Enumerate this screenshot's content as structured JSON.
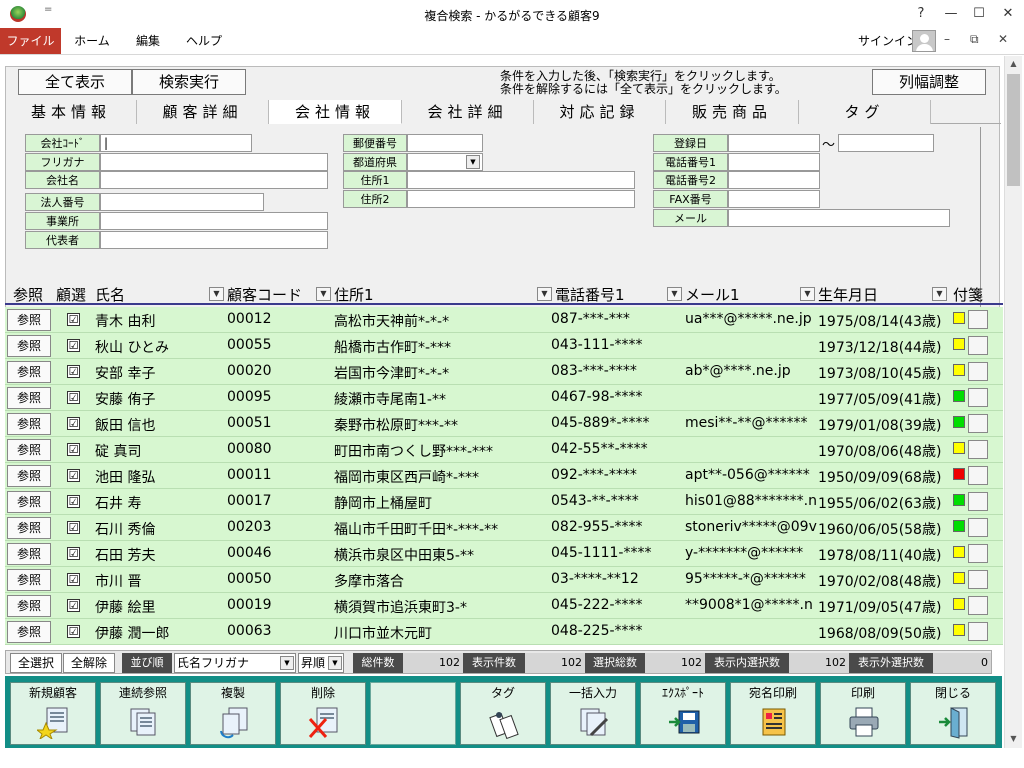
{
  "window": {
    "title": "複合検索 - かるがるできる顧客9",
    "qat": "=",
    "help": "?",
    "minimize": "—",
    "maximize": "☐",
    "close": "✕"
  },
  "menu": {
    "items": [
      "ファイル",
      "ホーム",
      "編集",
      "ヘルプ"
    ],
    "signin": "サインイン",
    "ribbon_min": "–",
    "ribbon_restore": "⧉",
    "ribbon_close": "✕"
  },
  "colors": {
    "accent": "#c0392b",
    "toolbar": "#128e86",
    "row": "#d7f7d0",
    "label": "#d9f5d4",
    "header_rule": "#3a3a8c"
  },
  "top": {
    "show_all": "全て表示",
    "search": "検索実行",
    "hint1": "条件を入力した後、「検索実行」をクリックします。",
    "hint2": "条件を解除するには「全て表示」をクリックします。",
    "col_width": "列幅調整"
  },
  "tabs": [
    {
      "label": "基本情報",
      "active": false
    },
    {
      "label": "顧客詳細",
      "active": false
    },
    {
      "label": "会社情報",
      "active": true
    },
    {
      "label": "会社詳細",
      "active": false
    },
    {
      "label": "対応記録",
      "active": false
    },
    {
      "label": "販売商品",
      "active": false
    },
    {
      "label": "タグ",
      "active": false
    }
  ],
  "form": {
    "company_code": {
      "label": "会社ｺｰﾄﾞ",
      "value": "|"
    },
    "furigana": {
      "label": "フリガナ",
      "value": ""
    },
    "company_name": {
      "label": "会社名",
      "value": ""
    },
    "corp_number": {
      "label": "法人番号",
      "value": ""
    },
    "office": {
      "label": "事業所",
      "value": ""
    },
    "representative": {
      "label": "代表者",
      "value": ""
    },
    "postal": {
      "label": "郵便番号",
      "value": ""
    },
    "prefecture": {
      "label": "都道府県",
      "value": ""
    },
    "address1": {
      "label": "住所1",
      "value": ""
    },
    "address2": {
      "label": "住所2",
      "value": ""
    },
    "reg_date": {
      "label": "登録日",
      "value": "",
      "sep": "～",
      "value_to": ""
    },
    "phone1": {
      "label": "電話番号1",
      "value": ""
    },
    "phone2": {
      "label": "電話番号2",
      "value": ""
    },
    "fax": {
      "label": "FAX番号",
      "value": ""
    },
    "mail": {
      "label": "メール",
      "value": ""
    }
  },
  "grid": {
    "headers": {
      "ref": "参照",
      "sel": "顧選",
      "name": "氏名",
      "code": "顧客コード",
      "addr": "住所1",
      "tel": "電話番号1",
      "mail": "メール1",
      "birth": "生年月日",
      "tag": "付箋"
    },
    "ref_label": "参照",
    "check": "☑",
    "rows": [
      {
        "name": "青木 由利",
        "code": "00012",
        "addr": "高松市天神前*-*-*",
        "tel": "087-***-***",
        "mail": "ua***@*****.ne.jp",
        "birth": "1975/08/14(43歳)",
        "tag": "#ffff00"
      },
      {
        "name": "秋山 ひとみ",
        "code": "00055",
        "addr": "船橋市古作町*-***",
        "tel": "043-111-****",
        "mail": "",
        "birth": "1973/12/18(44歳)",
        "tag": "#ffff00"
      },
      {
        "name": "安部 幸子",
        "code": "00020",
        "addr": "岩国市今津町*-*-*",
        "tel": "083-***-****",
        "mail": "ab*@****.ne.jp",
        "birth": "1973/08/10(45歳)",
        "tag": "#ffff00"
      },
      {
        "name": "安藤 侑子",
        "code": "00095",
        "addr": "綾瀬市寺尾南1-**",
        "tel": "0467-98-****",
        "mail": "",
        "birth": "1977/05/09(41歳)",
        "tag": "#00dd00"
      },
      {
        "name": "飯田 信也",
        "code": "00051",
        "addr": "秦野市松原町***-**",
        "tel": "045-889*-****",
        "mail": "mesi**-**@******",
        "birth": "1979/01/08(39歳)",
        "tag": "#00dd00"
      },
      {
        "name": "碇 真司",
        "code": "00080",
        "addr": "町田市南つくし野***-***",
        "tel": "042-55**-****",
        "mail": "",
        "birth": "1970/08/06(48歳)",
        "tag": "#ffff00"
      },
      {
        "name": "池田 隆弘",
        "code": "00011",
        "addr": "福岡市東区西戸崎*-***",
        "tel": "092-***-****",
        "mail": "apt**-056@******",
        "birth": "1950/09/09(68歳)",
        "tag": "#ee0000"
      },
      {
        "name": "石井 寿",
        "code": "00017",
        "addr": "静岡市上桶屋町",
        "tel": "0543-**-****",
        "mail": "his01@88*******.n",
        "birth": "1955/06/02(63歳)",
        "tag": "#00dd00"
      },
      {
        "name": "石川 秀倫",
        "code": "00203",
        "addr": "福山市千田町千田*-***-**",
        "tel": "082-955-****",
        "mail": "stoneriv*****@09v",
        "birth": "1960/06/05(58歳)",
        "tag": "#00dd00"
      },
      {
        "name": "石田 芳夫",
        "code": "00046",
        "addr": "横浜市泉区中田東5-**",
        "tel": "045-1111-****",
        "mail": "y-*******@******",
        "birth": "1978/08/11(40歳)",
        "tag": "#ffff00"
      },
      {
        "name": "市川 晋",
        "code": "00050",
        "addr": "多摩市落合",
        "tel": "03-****-**12",
        "mail": "95*****-*@******",
        "birth": "1970/02/08(48歳)",
        "tag": "#ffff00"
      },
      {
        "name": "伊藤 絵里",
        "code": "00019",
        "addr": "横須賀市追浜東町3-*",
        "tel": "045-222-****",
        "mail": "**9008*1@*****.n",
        "birth": "1971/09/05(47歳)",
        "tag": "#ffff00"
      },
      {
        "name": "伊藤 潤一郎",
        "code": "00063",
        "addr": "川口市並木元町",
        "tel": "048-225-****",
        "mail": "",
        "birth": "1968/08/09(50歳)",
        "tag": "#ffff00"
      }
    ]
  },
  "status": {
    "select_all": "全選択",
    "deselect_all": "全解除",
    "sort_label": "並び順",
    "sort_field": "氏名フリガナ",
    "sort_order": "昇順",
    "total_label": "総件数",
    "total": "102",
    "shown_label": "表示件数",
    "shown": "102",
    "sel_total_label": "選択総数",
    "sel_total": "102",
    "sel_in_label": "表示内選択数",
    "sel_in": "102",
    "sel_out_label": "表示外選択数",
    "sel_out": "0"
  },
  "toolbar": [
    {
      "label": "新規顧客",
      "icon": "new-customer-icon"
    },
    {
      "label": "連続参照",
      "icon": "continuous-view-icon"
    },
    {
      "label": "複製",
      "icon": "duplicate-icon"
    },
    {
      "label": "削除",
      "icon": "delete-icon"
    },
    {
      "label": "",
      "icon": ""
    },
    {
      "label": "タグ",
      "icon": "tag-icon"
    },
    {
      "label": "一括入力",
      "icon": "bulk-input-icon"
    },
    {
      "label": "ｴｸｽﾎﾟｰﾄ",
      "icon": "export-icon"
    },
    {
      "label": "宛名印刷",
      "icon": "address-print-icon"
    },
    {
      "label": "印刷",
      "icon": "print-icon"
    },
    {
      "label": "閉じる",
      "icon": "close-door-icon"
    }
  ],
  "scroll": {
    "up": "▲",
    "down": "▼"
  }
}
